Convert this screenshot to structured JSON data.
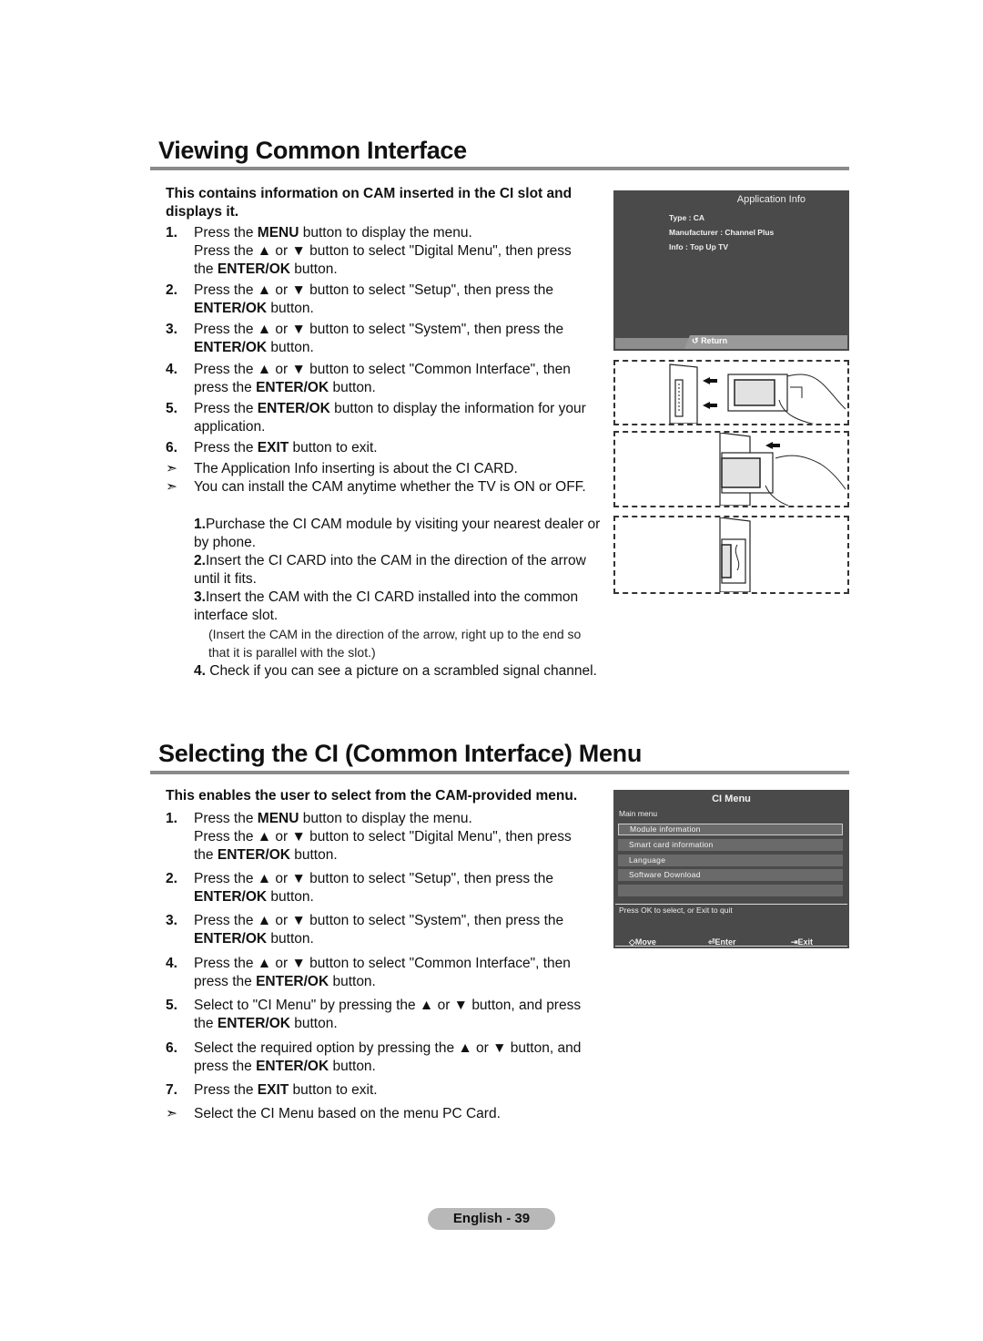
{
  "section1": {
    "title": "Viewing Common Interface",
    "intro": "This contains information on CAM inserted in the CI slot and displays it.",
    "steps": [
      {
        "num": "1.",
        "parts": [
          "Press the ",
          "MENU",
          " button to display the menu.",
          "Press the ▲ or ▼ button to select \"Digital Menu\", then press the ",
          "ENTER/OK",
          " button."
        ]
      },
      {
        "num": "2.",
        "parts": [
          "Press the ▲ or ▼ button to select \"Setup\", then press the ",
          "ENTER/OK",
          " button."
        ]
      },
      {
        "num": "3.",
        "parts": [
          "Press the ▲ or ▼ button to select \"System\", then press the ",
          "ENTER/OK",
          " button."
        ]
      },
      {
        "num": "4.",
        "parts": [
          "Press the ▲ or ▼ button to select \"Common Interface\", then press the ",
          "ENTER/OK",
          " button."
        ]
      },
      {
        "num": "5.",
        "parts": [
          "Press the ",
          "ENTER/OK",
          " button to display the information for your application."
        ]
      },
      {
        "num": "6.",
        "parts": [
          "Press the ",
          "EXIT",
          " button to exit."
        ]
      }
    ],
    "notes": [
      "The Application Info inserting is about the CI CARD.",
      "You can install the CAM anytime whether the TV is ON or OFF."
    ],
    "substeps": [
      {
        "num": "1.",
        "text": "Purchase the CI CAM module by visiting your nearest dealer or by phone."
      },
      {
        "num": "2.",
        "text": "Insert the CI CARD into the CAM in the direction of the arrow until it fits."
      },
      {
        "num": "3.",
        "text": "Insert the CAM with the CI CARD installed into the common interface slot."
      },
      {
        "num": "4.",
        "text": " Check if you can see a picture on a scrambled signal channel."
      }
    ],
    "substep3_note": "(Insert the CAM in the direction of the arrow, right up to the end so that it is parallel with the slot.)",
    "note_bullet": "➣"
  },
  "app_info_panel": {
    "title": "Application Info",
    "lines": [
      "Type : CA",
      "Manufacturer : Channel Plus",
      "Info : Top Up TV"
    ],
    "return_icon": "↺",
    "return_label": "Return"
  },
  "section2": {
    "title": "Selecting the CI (Common Interface) Menu",
    "intro": "This enables the user to select from the CAM-provided menu.",
    "steps": [
      {
        "num": "1.",
        "parts": [
          "Press the ",
          "MENU",
          " button to display the menu.",
          "Press the ▲ or ▼ button to select \"Digital Menu\", then press the ",
          "ENTER/OK",
          " button."
        ]
      },
      {
        "num": "2.",
        "parts": [
          "Press the ▲ or ▼ button to select \"Setup\", then press the ",
          "ENTER/OK",
          " button."
        ]
      },
      {
        "num": "3.",
        "parts": [
          "Press the ▲ or ▼ button to select \"System\", then press the ",
          "ENTER/OK",
          " button."
        ]
      },
      {
        "num": "4.",
        "parts": [
          "Press the ▲ or ▼ button to select \"Common Interface\", then press the ",
          "ENTER/OK",
          " button."
        ]
      },
      {
        "num": "5.",
        "parts": [
          "Select to \"CI Menu\" by pressing the ▲ or ▼ button, and press the ",
          "ENTER/OK",
          " button."
        ]
      },
      {
        "num": "6.",
        "parts": [
          "Select the required option by pressing the ▲ or ▼ button, and press the ",
          "ENTER/OK",
          " button."
        ]
      },
      {
        "num": "7.",
        "parts": [
          "Press the ",
          "EXIT",
          " button to exit."
        ]
      }
    ],
    "note": "Select the CI Menu based on the menu PC Card.",
    "note_bullet": "➣"
  },
  "ci_menu_panel": {
    "title": "CI Menu",
    "subtitle": "Main menu",
    "items": [
      "Module information",
      "Smart card information",
      "Language",
      "Software Download",
      ""
    ],
    "selected_index": 0,
    "hint": "Press OK to select, or Exit to quit",
    "footer": [
      {
        "icon": "◇",
        "label": "Move"
      },
      {
        "icon": "⏎",
        "label": "Enter"
      },
      {
        "icon": "⇥",
        "label": "Exit"
      }
    ]
  },
  "page": {
    "label": "English - 39"
  }
}
